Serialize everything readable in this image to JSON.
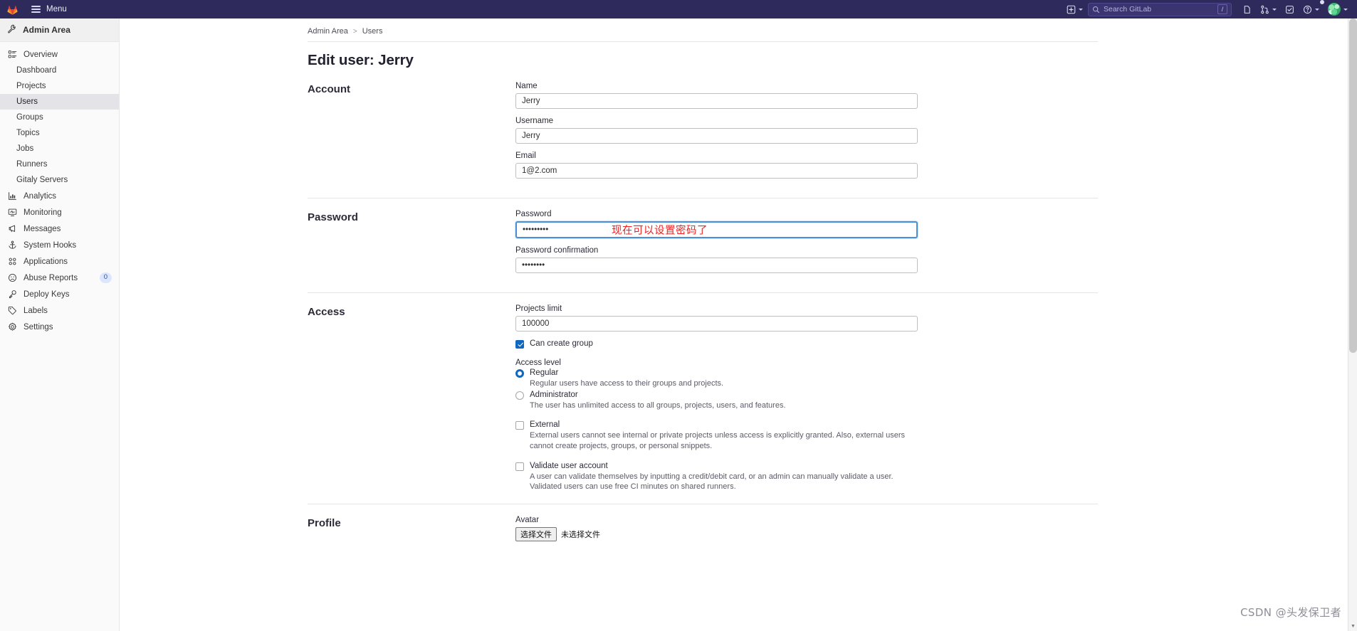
{
  "topnav": {
    "logo_icon": "gitlab-tanuki-icon",
    "menu_label": "Menu",
    "create_icon": "plus-square-icon",
    "search": {
      "placeholder": "Search GitLab",
      "value": "",
      "icon": "search-icon",
      "shortcut_key": "/"
    },
    "issues_icon": "issues-icon",
    "merge_requests_icon": "merge-request-icon",
    "todos_icon": "todo-checkbox-icon",
    "help_icon": "question-circle-icon",
    "avatar_icon": "user-avatar-icon"
  },
  "sidebar": {
    "context": {
      "label": "Admin Area",
      "icon": "wrench-icon"
    },
    "items": [
      {
        "label": "Overview",
        "icon": "overview-icon",
        "level": "top",
        "active": false
      },
      {
        "label": "Dashboard",
        "icon": "",
        "level": "sub",
        "active": false
      },
      {
        "label": "Projects",
        "icon": "",
        "level": "sub",
        "active": false
      },
      {
        "label": "Users",
        "icon": "",
        "level": "sub",
        "active": true
      },
      {
        "label": "Groups",
        "icon": "",
        "level": "sub",
        "active": false
      },
      {
        "label": "Topics",
        "icon": "",
        "level": "sub",
        "active": false
      },
      {
        "label": "Jobs",
        "icon": "",
        "level": "sub",
        "active": false
      },
      {
        "label": "Runners",
        "icon": "",
        "level": "sub",
        "active": false
      },
      {
        "label": "Gitaly Servers",
        "icon": "",
        "level": "sub",
        "active": false
      },
      {
        "label": "Analytics",
        "icon": "chart-icon",
        "level": "top",
        "active": false
      },
      {
        "label": "Monitoring",
        "icon": "monitor-icon",
        "level": "top",
        "active": false
      },
      {
        "label": "Messages",
        "icon": "megaphone-icon",
        "level": "top",
        "active": false
      },
      {
        "label": "System Hooks",
        "icon": "anchor-icon",
        "level": "top",
        "active": false
      },
      {
        "label": "Applications",
        "icon": "apps-grid-icon",
        "level": "top",
        "active": false
      },
      {
        "label": "Abuse Reports",
        "icon": "frown-face-icon",
        "level": "top",
        "active": false,
        "count": "0"
      },
      {
        "label": "Deploy Keys",
        "icon": "key-icon",
        "level": "top",
        "active": false
      },
      {
        "label": "Labels",
        "icon": "label-tag-icon",
        "level": "top",
        "active": false
      },
      {
        "label": "Settings",
        "icon": "gear-icon",
        "level": "top",
        "active": false
      }
    ]
  },
  "breadcrumb": {
    "root": "Admin Area",
    "separator": ">",
    "current": "Users"
  },
  "page": {
    "title": "Edit user: Jerry"
  },
  "sections": {
    "account": {
      "title": "Account",
      "name_label": "Name",
      "name_value": "Jerry",
      "username_label": "Username",
      "username_value": "Jerry",
      "email_label": "Email",
      "email_value": "1@2.com"
    },
    "password": {
      "title": "Password",
      "password_label": "Password",
      "password_value": "•••••••••",
      "annotation": "现在可以设置密码了",
      "annotation_color": "#f02020",
      "confirmation_label": "Password confirmation",
      "confirmation_value": "••••••••"
    },
    "access": {
      "title": "Access",
      "projects_limit_label": "Projects limit",
      "projects_limit_value": "100000",
      "can_create_group_label": "Can create group",
      "can_create_group_checked": true,
      "access_level_label": "Access level",
      "options": [
        {
          "label": "Regular",
          "description": "Regular users have access to their groups and projects.",
          "selected": true
        },
        {
          "label": "Administrator",
          "description": "The user has unlimited access to all groups, projects, users, and features.",
          "selected": false
        }
      ],
      "external_label": "External",
      "external_checked": false,
      "external_description": "External users cannot see internal or private projects unless access is explicitly granted. Also, external users cannot create projects, groups, or personal snippets.",
      "validate_label": "Validate user account",
      "validate_checked": false,
      "validate_description": "A user can validate themselves by inputting a credit/debit card, or an admin can manually validate a user. Validated users can use free CI minutes on shared runners."
    },
    "profile": {
      "title": "Profile",
      "avatar_label": "Avatar",
      "file_button": "选择文件",
      "file_status": "未选择文件"
    }
  },
  "watermark": "CSDN @头发保卫者"
}
